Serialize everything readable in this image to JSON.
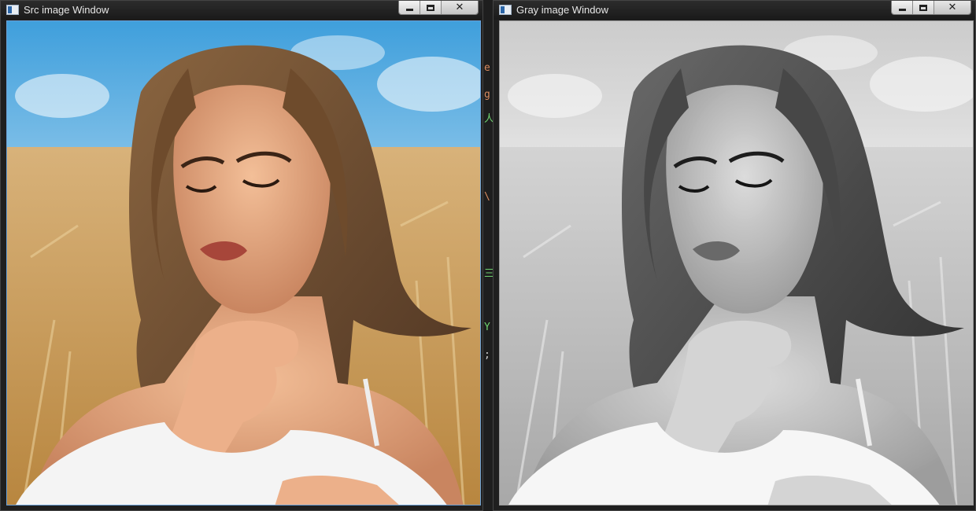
{
  "windows": [
    {
      "title": "Src image Window",
      "kind": "color"
    },
    {
      "title": "Gray image Window",
      "kind": "grayscale"
    }
  ],
  "window_controls": {
    "minimize": "minimize-icon",
    "maximize": "maximize-icon",
    "close": "close-icon"
  },
  "editor_strip_glyphs": [
    "e",
    "g",
    "人",
    "\\",
    "三",
    "Y",
    ";"
  ],
  "colors": {
    "sky": "#4aa7e0",
    "wheat": "#c89a55",
    "skin": "#e2a07a",
    "hair": "#6b4a2e",
    "dress": "#f4f4f4",
    "window_frame": "#1f1f1f",
    "canvas_border_active": "#6aa0d6"
  }
}
